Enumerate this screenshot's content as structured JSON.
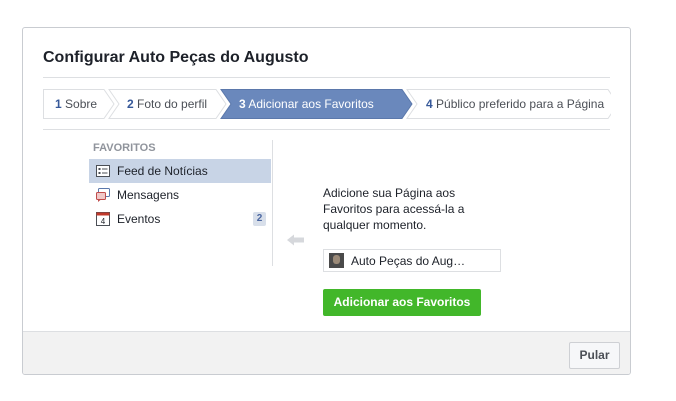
{
  "dialog": {
    "title": "Configurar Auto Peças do Augusto"
  },
  "steps": [
    {
      "number": "1",
      "label": "Sobre",
      "active": false
    },
    {
      "number": "2",
      "label": "Foto do perfil",
      "active": false
    },
    {
      "number": "3",
      "label": "Adicionar aos Favoritos",
      "active": true
    },
    {
      "number": "4",
      "label": "Público preferido para a Página",
      "active": false
    }
  ],
  "favorites": {
    "heading": "FAVORITOS",
    "items": [
      {
        "label": "Feed de Notícias",
        "icon": "news-feed-icon",
        "selected": true,
        "badge": ""
      },
      {
        "label": "Mensagens",
        "icon": "messages-icon",
        "selected": false,
        "badge": ""
      },
      {
        "label": "Eventos",
        "icon": "calendar-icon",
        "selected": false,
        "badge": "2",
        "calendar_day": "4"
      }
    ]
  },
  "main": {
    "description": "Adicione sua Página aos Favoritos para acessá-la a qualquer momento.",
    "page_name": "Auto Peças do Aug…",
    "add_button": "Adicionar aos Favoritos"
  },
  "footer": {
    "skip_button": "Pular"
  },
  "colors": {
    "active_step": "#6a88bc",
    "accent_blue": "#365899",
    "add_button": "#42b72a",
    "selected_row": "#c8d4e6"
  }
}
